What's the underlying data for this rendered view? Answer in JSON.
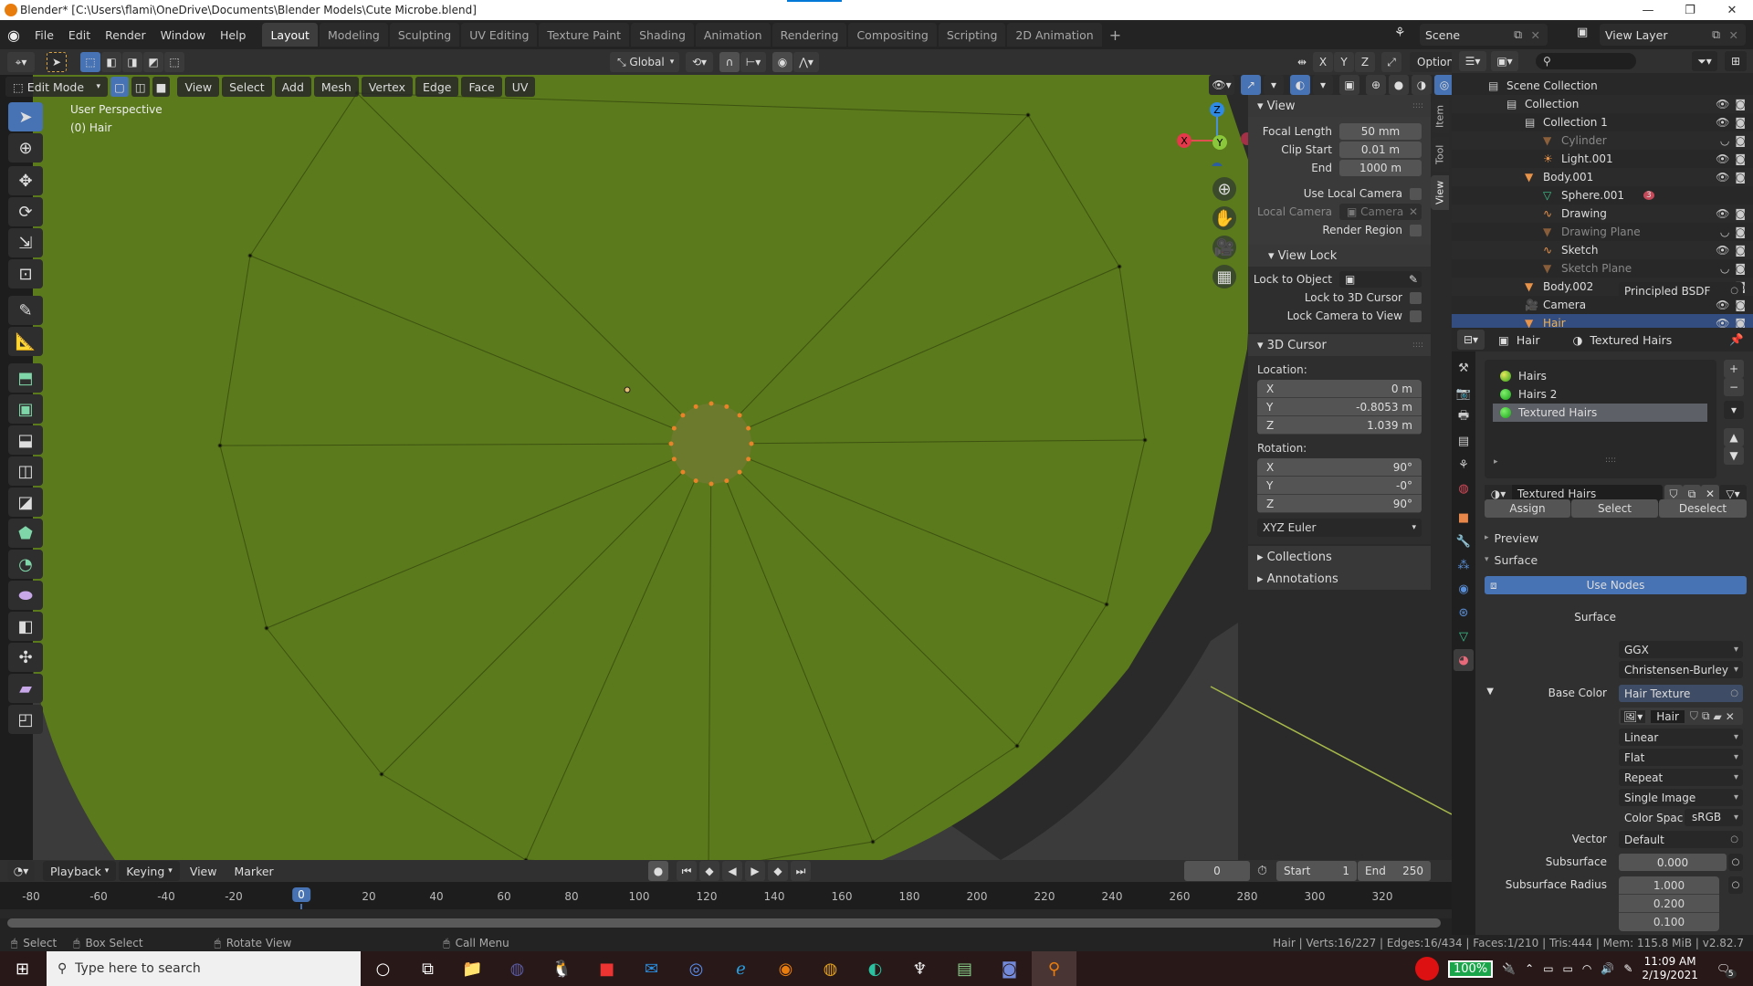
{
  "window": {
    "title": "Blender* [C:\\Users\\flami\\OneDrive\\Documents\\Blender Models\\Cute Microbe.blend]",
    "controls": [
      "—",
      "❐",
      "✕"
    ]
  },
  "menu": [
    "File",
    "Edit",
    "Render",
    "Window",
    "Help"
  ],
  "workspaces": [
    {
      "label": "Layout",
      "active": true
    },
    {
      "label": "Modeling"
    },
    {
      "label": "Sculpting"
    },
    {
      "label": "UV Editing"
    },
    {
      "label": "Texture Paint"
    },
    {
      "label": "Shading"
    },
    {
      "label": "Animation"
    },
    {
      "label": "Rendering"
    },
    {
      "label": "Compositing"
    },
    {
      "label": "Scripting"
    },
    {
      "label": "2D Animation"
    }
  ],
  "workspace_add": "+",
  "scene": {
    "label": "Scene",
    "view_layer": "View Layer"
  },
  "tool_header": {
    "orientation": "Global",
    "axes": [
      "X",
      "Y",
      "Z"
    ],
    "options": "Options"
  },
  "viewport": {
    "mode": "Edit Mode",
    "menus": [
      "View",
      "Select",
      "Add",
      "Mesh",
      "Vertex",
      "Edge",
      "Face",
      "UV"
    ],
    "perspective": "User Perspective",
    "object_label": "(0) Hair",
    "gizmo": {
      "x": "X",
      "y": "Y",
      "z": "Z"
    },
    "mesh_color": "#5a7a1c"
  },
  "npanel": {
    "tabs": [
      "Item",
      "Tool",
      "View"
    ],
    "active_tab": "View",
    "view": {
      "title": "View",
      "focal_length_label": "Focal Length",
      "focal_length": "50 mm",
      "clip_start_label": "Clip Start",
      "clip_start": "0.01 m",
      "end_label": "End",
      "end": "1000 m",
      "use_local_camera": "Use Local Camera",
      "local_camera_label": "Local Camera",
      "local_camera": "Camera",
      "render_region": "Render Region"
    },
    "view_lock": {
      "title": "View Lock",
      "lock_to_object": "Lock to Object",
      "lock_to_cursor": "Lock to 3D Cursor",
      "lock_camera": "Lock Camera to View"
    },
    "cursor": {
      "title": "3D Cursor",
      "location_label": "Location:",
      "location": [
        {
          "axis": "X",
          "value": "0 m"
        },
        {
          "axis": "Y",
          "value": "-0.8053 m"
        },
        {
          "axis": "Z",
          "value": "1.039 m"
        }
      ],
      "rotation_label": "Rotation:",
      "rotation": [
        {
          "axis": "X",
          "value": "90°"
        },
        {
          "axis": "Y",
          "value": "-0°"
        },
        {
          "axis": "Z",
          "value": "90°"
        }
      ],
      "rotation_mode": "XYZ Euler"
    },
    "collections": "Collections",
    "annotations": "Annotations"
  },
  "outliner": {
    "rows": [
      {
        "label": "Scene Collection",
        "depth": 0
      },
      {
        "label": "Collection",
        "depth": 1,
        "visible": true
      },
      {
        "label": "Collection 1",
        "depth": 2,
        "visible": true
      },
      {
        "label": "Cylinder",
        "depth": 3,
        "dim": true,
        "visible": false
      },
      {
        "label": "Light.001",
        "depth": 3,
        "visible": true
      },
      {
        "label": "Body.001",
        "depth": 2,
        "visible": true
      },
      {
        "label": "Sphere.001",
        "depth": 3,
        "badge": "3"
      },
      {
        "label": "Drawing",
        "depth": 3,
        "visible": true
      },
      {
        "label": "Drawing Plane",
        "depth": 3,
        "dim": true,
        "visible": false
      },
      {
        "label": "Sketch",
        "depth": 3,
        "visible": true
      },
      {
        "label": "Sketch Plane",
        "depth": 3,
        "dim": true,
        "visible": false
      },
      {
        "label": "Body.002",
        "depth": 2,
        "visible": true
      },
      {
        "label": "Camera",
        "depth": 2,
        "visible": true
      },
      {
        "label": "Hair",
        "depth": 2,
        "visible": true,
        "selected": true
      }
    ]
  },
  "properties": {
    "object": "Hair",
    "material": "Textured Hairs",
    "slots": [
      "Hairs",
      "Hairs 2",
      "Textured Hairs"
    ],
    "selected_slot": 2,
    "material_field": "Textured Hairs",
    "buttons": {
      "assign": "Assign",
      "select": "Select",
      "deselect": "Deselect"
    },
    "preview": "Preview",
    "surface_panel": "Surface",
    "use_nodes": "Use Nodes",
    "surface_label": "Surface",
    "surface": "Principled BSDF",
    "distribution": "GGX",
    "subsurface_method": "Christensen-Burley",
    "base_color_label": "Base Color",
    "base_color": "Hair Texture",
    "image": "Hair",
    "interpolation": "Linear",
    "projection": "Flat",
    "extension": "Repeat",
    "source": "Single Image",
    "color_space_label": "Color Spac",
    "color_space": "sRGB",
    "vector_label": "Vector",
    "vector": "Default",
    "subsurface_label": "Subsurface",
    "subsurface": "0.000",
    "subsurface_radius_label": "Subsurface Radius",
    "subsurface_radius": [
      "1.000",
      "0.200",
      "0.100"
    ]
  },
  "timeline": {
    "menus": [
      "Playback",
      "Keying",
      "View",
      "Marker"
    ],
    "current_frame": "0",
    "start_label": "Start",
    "start": "1",
    "end_label": "End",
    "end": "250",
    "ticks": [
      "-80",
      "-60",
      "-40",
      "-20",
      "0",
      "20",
      "40",
      "60",
      "80",
      "100",
      "120",
      "140",
      "160",
      "180",
      "200",
      "220",
      "240",
      "260",
      "280",
      "300",
      "320"
    ]
  },
  "statusbar": {
    "hints": [
      "Select",
      "Box Select",
      "Rotate View",
      "Call Menu"
    ],
    "stats": "Hair | Verts:16/227 | Edges:16/434 | Faces:1/210 | Tris:444 | Mem: 115.8 MiB | v2.82.7"
  },
  "taskbar": {
    "search_placeholder": "Type here to search",
    "battery": "100%",
    "time": "11:09 AM",
    "date": "2/19/2021",
    "notifications": "5"
  }
}
